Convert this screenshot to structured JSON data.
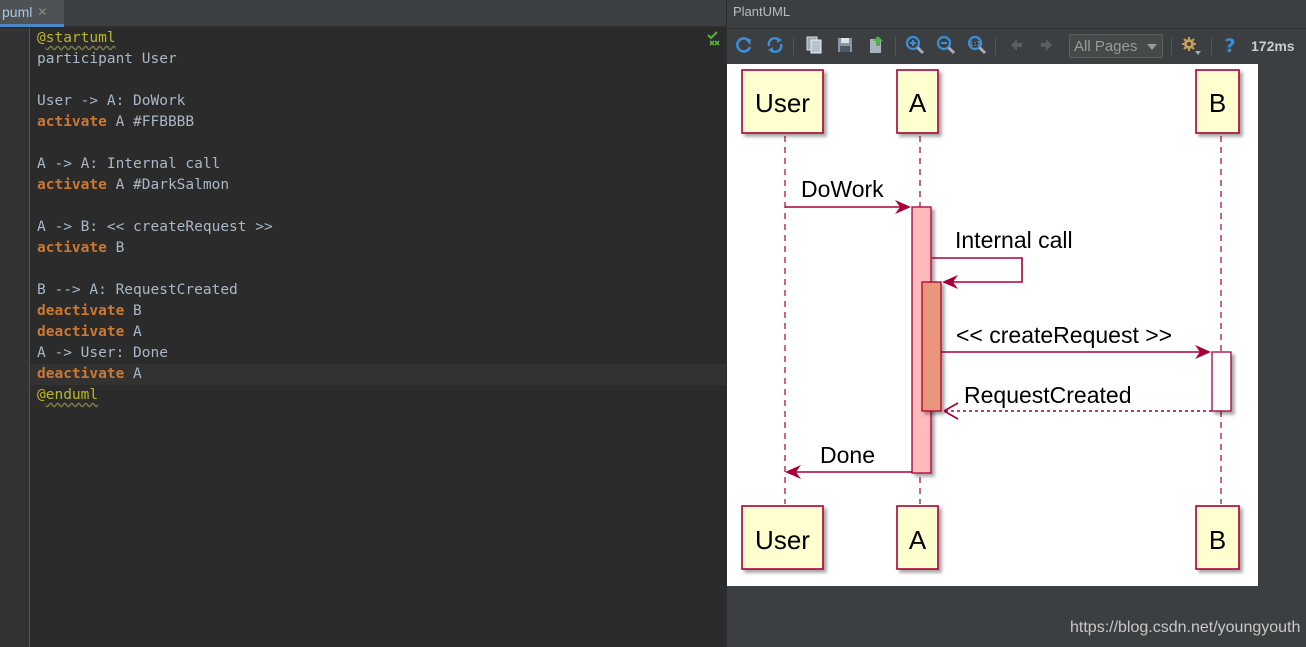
{
  "editor": {
    "tab_label": "puml",
    "lines": [
      {
        "tokens": [
          {
            "t": "@",
            "c": "annAt"
          },
          {
            "t": "startuml",
            "c": "ann"
          }
        ]
      },
      {
        "tokens": [
          {
            "t": "participant User",
            "c": ""
          }
        ]
      },
      {
        "tokens": [
          {
            "t": "",
            "c": ""
          }
        ]
      },
      {
        "tokens": [
          {
            "t": "User -> A: DoWork",
            "c": ""
          }
        ]
      },
      {
        "tokens": [
          {
            "t": "activate",
            "c": "kw"
          },
          {
            "t": " A #FFBBBB",
            "c": ""
          }
        ]
      },
      {
        "tokens": [
          {
            "t": "",
            "c": ""
          }
        ]
      },
      {
        "tokens": [
          {
            "t": "A -> A: Internal call",
            "c": ""
          }
        ]
      },
      {
        "tokens": [
          {
            "t": "activate",
            "c": "kw"
          },
          {
            "t": " A #DarkSalmon",
            "c": ""
          }
        ]
      },
      {
        "tokens": [
          {
            "t": "",
            "c": ""
          }
        ]
      },
      {
        "tokens": [
          {
            "t": "A -> B: << createRequest >>",
            "c": ""
          }
        ]
      },
      {
        "tokens": [
          {
            "t": "activate",
            "c": "kw"
          },
          {
            "t": " B",
            "c": ""
          }
        ]
      },
      {
        "tokens": [
          {
            "t": "",
            "c": ""
          }
        ]
      },
      {
        "tokens": [
          {
            "t": "B --> A: RequestCreated",
            "c": ""
          }
        ]
      },
      {
        "tokens": [
          {
            "t": "deactivate",
            "c": "kw"
          },
          {
            "t": " B",
            "c": ""
          }
        ]
      },
      {
        "tokens": [
          {
            "t": "deactivate",
            "c": "kw"
          },
          {
            "t": " A",
            "c": ""
          }
        ]
      },
      {
        "tokens": [
          {
            "t": "A -> User: Done",
            "c": ""
          }
        ]
      },
      {
        "tokens": [
          {
            "t": "deactivate",
            "c": "kw"
          },
          {
            "t": " A",
            "c": ""
          }
        ]
      },
      {
        "tokens": [
          {
            "t": "@",
            "c": "annAt"
          },
          {
            "t": "enduml",
            "c": "ann"
          }
        ]
      }
    ]
  },
  "viewer": {
    "title": "PlantUML",
    "pages_select": "All Pages",
    "timing": "172ms",
    "toolbar_icons": [
      "refresh-icon",
      "reload-icon",
      "copy-icon",
      "save-icon",
      "export-icon",
      "zoom-in-icon",
      "zoom-out-icon",
      "zoom-actual-icon",
      "back-icon",
      "forward-icon",
      "settings-icon",
      "help-icon"
    ]
  },
  "diagram": {
    "participants": {
      "user": "User",
      "a": "A",
      "b": "B"
    },
    "messages": {
      "dowork": "DoWork",
      "internal": "Internal call",
      "create": "<< createRequest >>",
      "created": "RequestCreated",
      "done": "Done"
    },
    "colors": {
      "participant_fill": "#FEFECE",
      "participant_border": "#A80036",
      "activation_a": "#FFBBBB",
      "activation_a2": "#E9967A",
      "activation_b": "#FFFFFF"
    }
  },
  "watermark": "https://blog.csdn.net/youngyouth"
}
